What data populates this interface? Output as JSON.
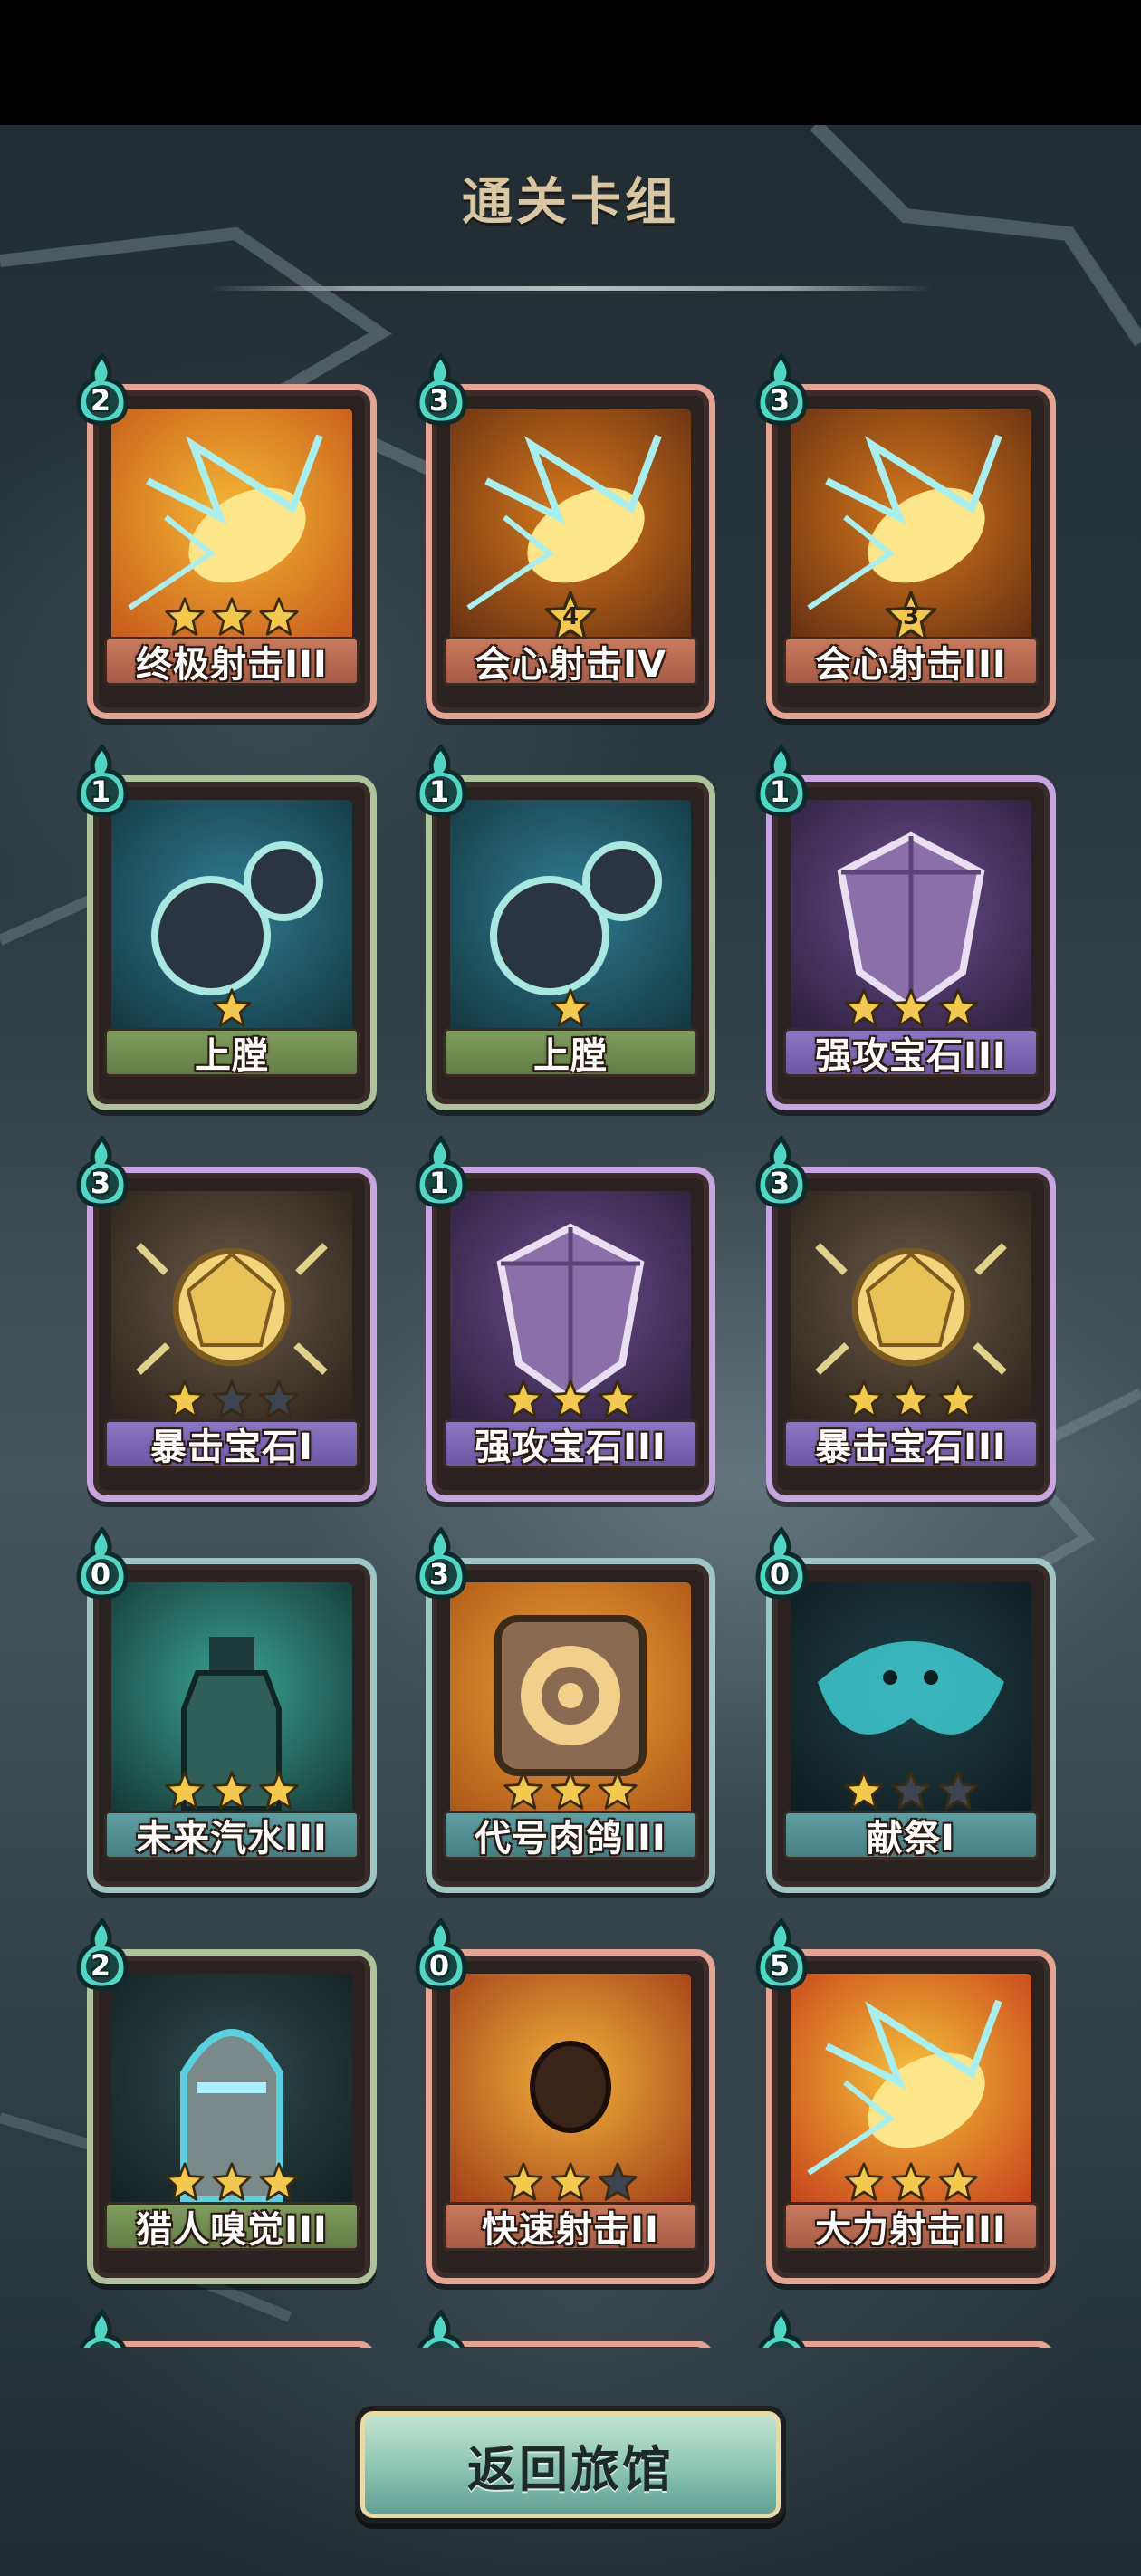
{
  "header": {
    "title": "通关卡组"
  },
  "footer": {
    "back_label": "返回旅馆"
  },
  "colors": {
    "title": "#d9c7a4",
    "star_filled": "#f2c94c",
    "star_empty": "#3d4452"
  },
  "cards": [
    {
      "name": "终极射击III",
      "cost": "2",
      "stars": 3,
      "max_stars": 3,
      "rarity": "red",
      "art": "lightning-slash"
    },
    {
      "name": "会心射击IV",
      "cost": "3",
      "stars": 4,
      "max_stars": 4,
      "rarity": "red",
      "art": "critical-shot",
      "star_badge": "4"
    },
    {
      "name": "会心射击III",
      "cost": "3",
      "stars": 3,
      "max_stars": 3,
      "rarity": "red",
      "art": "critical-shot",
      "star_badge": "3"
    },
    {
      "name": "上膛",
      "cost": "1",
      "stars": 1,
      "max_stars": 1,
      "rarity": "green",
      "art": "bullets"
    },
    {
      "name": "上膛",
      "cost": "1",
      "stars": 1,
      "max_stars": 1,
      "rarity": "green",
      "art": "bullets"
    },
    {
      "name": "强攻宝石III",
      "cost": "1",
      "stars": 3,
      "max_stars": 3,
      "rarity": "purple",
      "art": "purple-gem"
    },
    {
      "name": "暴击宝石I",
      "cost": "3",
      "stars": 1,
      "max_stars": 3,
      "rarity": "purple",
      "art": "gold-gem"
    },
    {
      "name": "强攻宝石III",
      "cost": "1",
      "stars": 3,
      "max_stars": 3,
      "rarity": "purple",
      "art": "purple-gem"
    },
    {
      "name": "暴击宝石III",
      "cost": "3",
      "stars": 3,
      "max_stars": 3,
      "rarity": "purple",
      "art": "gold-gem"
    },
    {
      "name": "未来汽水III",
      "cost": "0",
      "stars": 3,
      "max_stars": 3,
      "rarity": "teal",
      "art": "bottle"
    },
    {
      "name": "代号肉鸽III",
      "cost": "3",
      "stars": 3,
      "max_stars": 3,
      "rarity": "teal",
      "art": "badge"
    },
    {
      "name": "献祭I",
      "cost": "0",
      "stars": 1,
      "max_stars": 3,
      "rarity": "teal",
      "art": "sacrifice"
    },
    {
      "name": "猎人嗅觉III",
      "cost": "2",
      "stars": 3,
      "max_stars": 3,
      "rarity": "green",
      "art": "hunter"
    },
    {
      "name": "快速射击II",
      "cost": "0",
      "stars": 2,
      "max_stars": 3,
      "rarity": "red",
      "art": "bullet-orange"
    },
    {
      "name": "大力射击III",
      "cost": "5",
      "stars": 3,
      "max_stars": 3,
      "rarity": "red",
      "art": "power-shot"
    },
    {
      "name": "",
      "cost": "",
      "stars": 0,
      "max_stars": 0,
      "rarity": "red",
      "art": "hidden"
    },
    {
      "name": "",
      "cost": "",
      "stars": 0,
      "max_stars": 0,
      "rarity": "red",
      "art": "hidden"
    },
    {
      "name": "",
      "cost": "",
      "stars": 0,
      "max_stars": 0,
      "rarity": "red",
      "art": "hidden"
    }
  ]
}
